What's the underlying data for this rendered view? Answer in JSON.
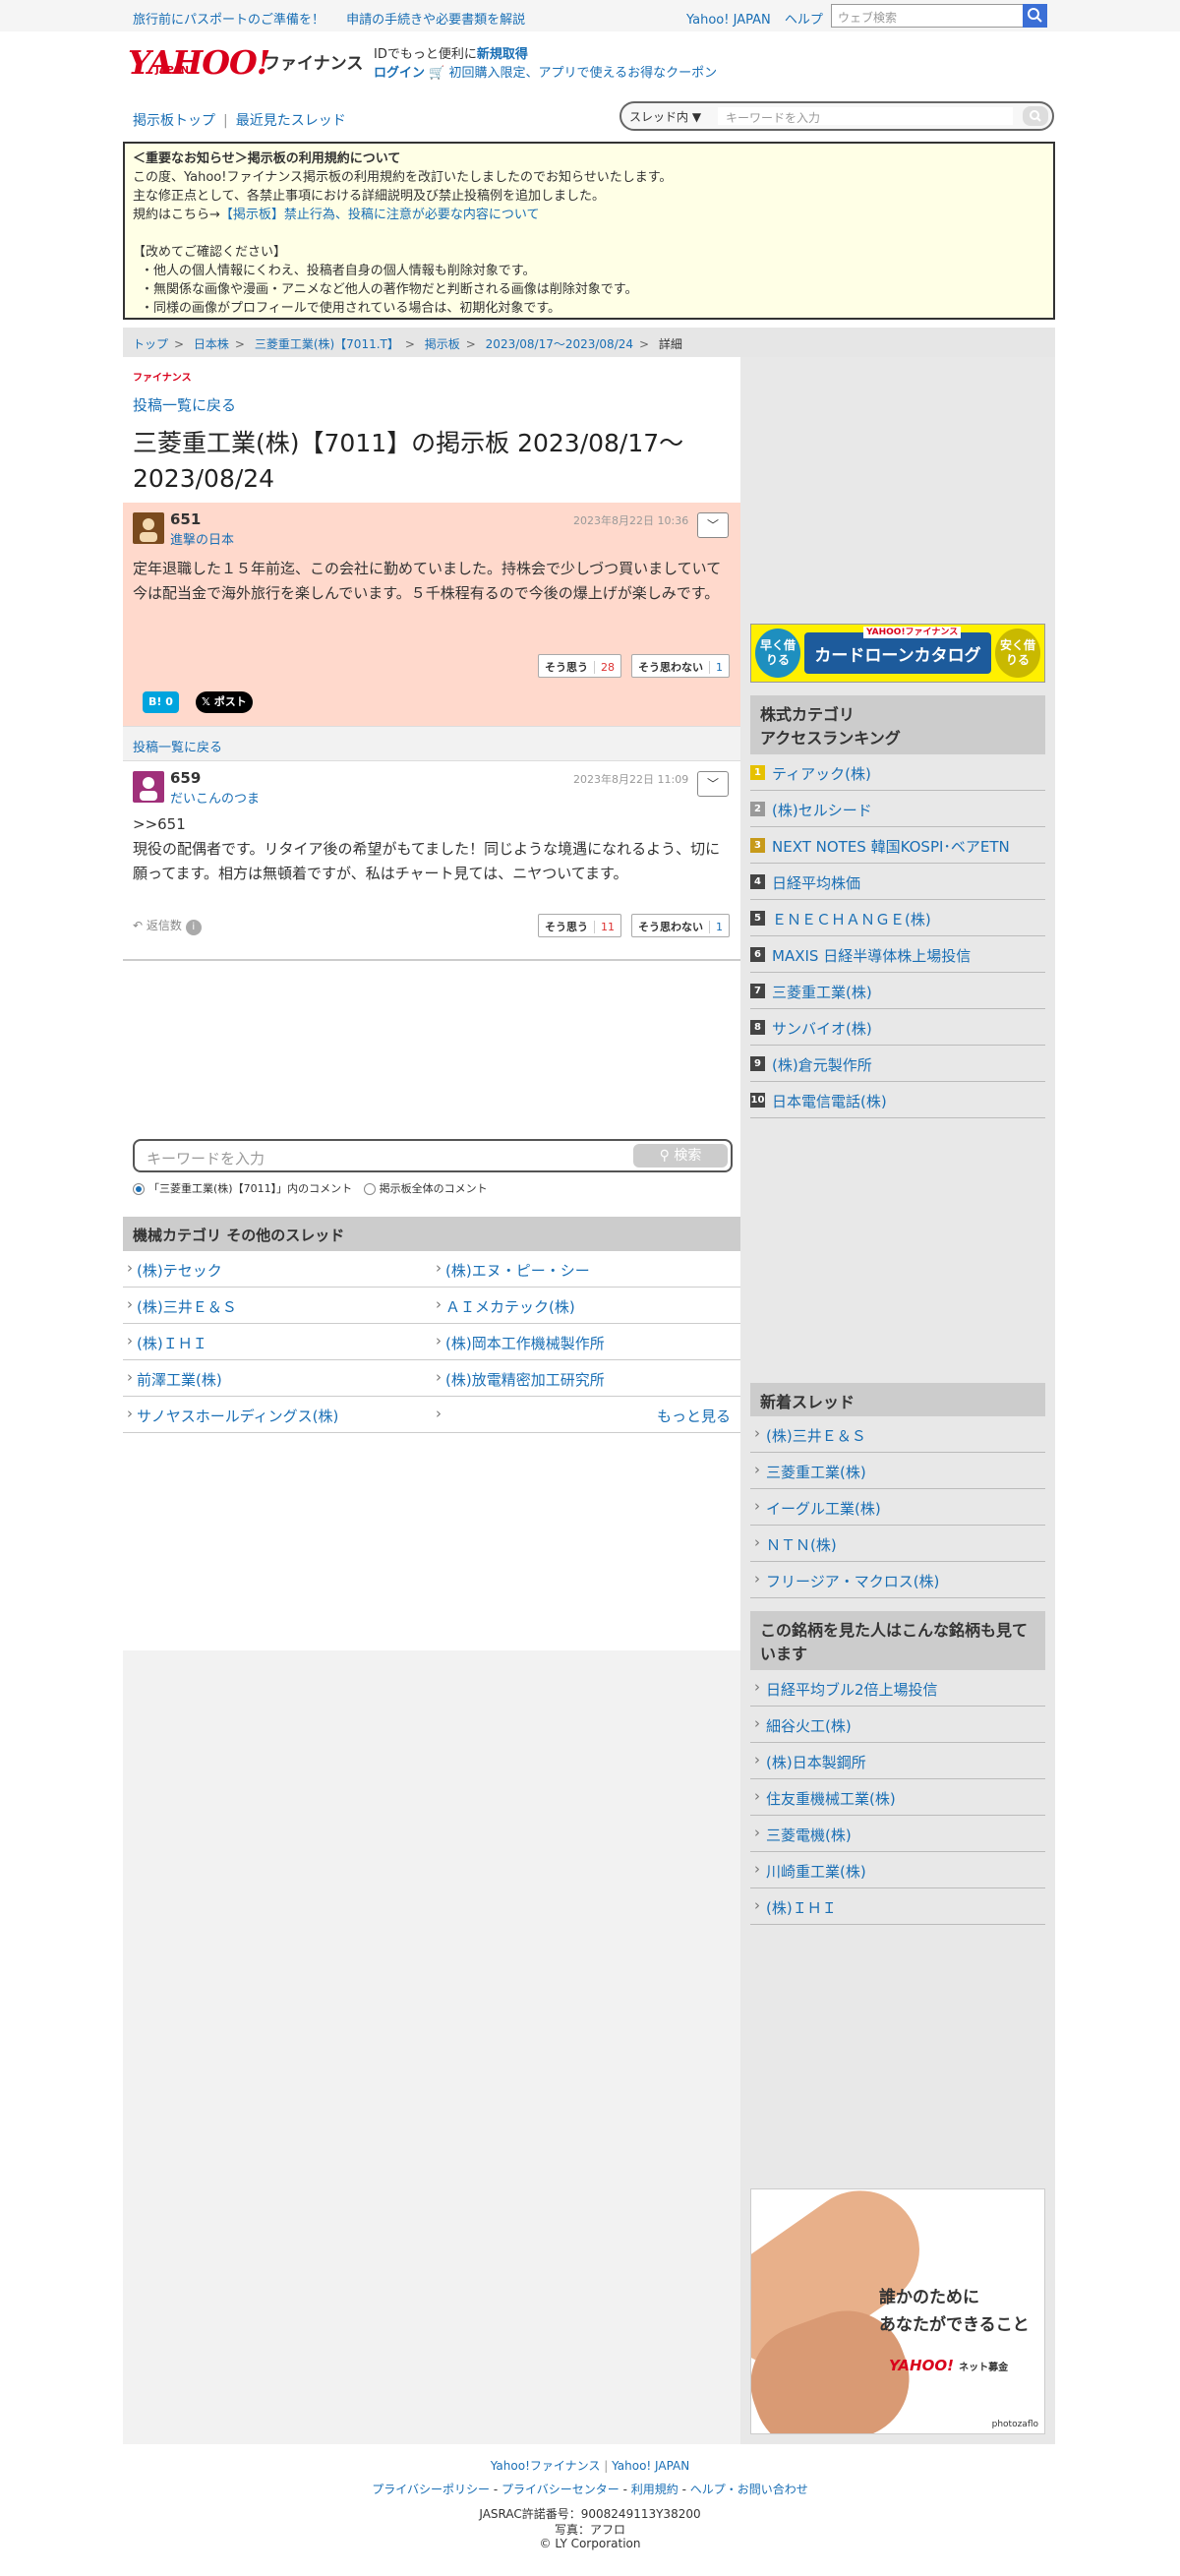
{
  "topbar": {
    "left_links": [
      "旅行前にパスポートのご準備を！",
      "申請の手続きや必要書類を解説"
    ],
    "right_links": [
      "Yahoo! JAPAN",
      "ヘルプ"
    ],
    "search_placeholder": "ウェブ検索"
  },
  "header": {
    "logo": "YAHOO!",
    "logo_sub": "JAPAN",
    "service": "ファイナンス",
    "id_text": "IDでもっと便利に",
    "signup": "新規取得",
    "login": "ログイン",
    "coupon": "初回購入限定、アプリで使えるお得なクーポン"
  },
  "subnav": {
    "board_top": "掲示板トップ",
    "recent": "最近見たスレッド",
    "scope": "スレッド内",
    "placeholder": "キーワードを入力"
  },
  "notice": {
    "title": "＜重要なお知らせ＞掲示板の利用規約について",
    "lines": [
      "この度、Yahoo!ファイナンス掲示板の利用規約を改訂いたしましたのでお知らせいたします。",
      "主な修正点として、各禁止事項における詳細説明及び禁止投稿例を追加しました。"
    ],
    "rule_prefix": "規約はこちら→",
    "rule_link": "【掲示板】禁止行為、投稿に注意が必要な内容について",
    "confirm": "【改めてご確認ください】",
    "bullets": [
      "・他人の個人情報にくわえ、投稿者自身の個人情報も削除対象です。",
      "・無関係な画像や漫画・アニメなど他人の著作物だと判断される画像は削除対象です。",
      "・同様の画像がプロフィールで使用されている場合は、初期化対象です。"
    ]
  },
  "breadcrumb": [
    "トップ",
    "日本株",
    "三菱重工業(株)【7011.T】",
    "掲示板",
    "2023/08/17〜2023/08/24",
    "詳細"
  ],
  "main": {
    "small_logo": "ファイナンス",
    "back": "投稿一覧に戻る",
    "title": "三菱重工業(株)【7011】の掲示板 2023/08/17〜2023/08/24"
  },
  "posts": [
    {
      "num": "651",
      "name": "進撃の日本",
      "date": "2023年8月22日 10:36",
      "body": "定年退職した１５年前迄、この会社に勤めていました。持株会で少しづつ買いましていて今は配当金で海外旅行を楽しんでいます。５千株程有るので今後の爆上げが楽しみです。",
      "yes_label": "そう思う",
      "yes": "28",
      "no_label": "そう思わない",
      "no": "1",
      "hatena": "B! 0",
      "xpost": "ポスト"
    },
    {
      "num": "659",
      "name": "だいこんのつま",
      "date": "2023年8月22日 11:09",
      "body": ">>651\n現役の配偶者です。リタイア後の希望がもてました！同じような境遇になれるよう、切に願ってます。相方は無頓着ですが、私はチャート見ては、ニヤついてます。",
      "yes_label": "そう思う",
      "yes": "11",
      "no_label": "そう思わない",
      "no": "1",
      "reply": "返信数"
    }
  ],
  "back2": "投稿一覧に戻る",
  "search": {
    "placeholder": "キーワードを入力",
    "button": "検索",
    "opt1": "「三菱重工業(株)【7011】」内のコメント",
    "opt2": "掲示板全体のコメント"
  },
  "other": {
    "title": "機械カテゴリ その他のスレッド",
    "items": [
      "(株)テセック",
      "(株)エヌ・ピー・シー",
      "(株)三井Ｅ＆Ｓ",
      "ＡＩメカテック(株)",
      "(株)ＩＨＩ",
      "(株)岡本工作機械製作所",
      "前澤工業(株)",
      "(株)放電精密加工研究所",
      "サノヤスホールディングス(株)"
    ],
    "more": "もっと見る"
  },
  "ad1": {
    "left": "早く借りる",
    "center": "カードローンカタログ",
    "brand": "YAHOO!ファイナンス",
    "right": "安く借りる"
  },
  "ranking": {
    "title1": "株式カテゴリ",
    "title2": "アクセスランキング",
    "items": [
      "ティアック(株)",
      "(株)セルシード",
      "NEXT NOTES 韓国KOSPI･ベアETN",
      "日経平均株価",
      "ＥＮＥＣＨＡＮＧＥ(株)",
      "MAXIS 日経半導体株上場投信",
      "三菱重工業(株)",
      "サンバイオ(株)",
      "(株)倉元製作所",
      "日本電信電話(株)"
    ]
  },
  "new_threads": {
    "title": "新着スレッド",
    "items": [
      "(株)三井Ｅ＆Ｓ",
      "三菱重工業(株)",
      "イーグル工業(株)",
      "ＮＴＮ(株)",
      "フリージア・マクロス(株)"
    ]
  },
  "also_viewed": {
    "title": "この銘柄を見た人はこんな銘柄も見ています",
    "items": [
      "日経平均ブル2倍上場投信",
      "細谷火工(株)",
      "(株)日本製鋼所",
      "住友重機械工業(株)",
      "三菱電機(株)",
      "川崎重工業(株)",
      "(株)ＩＨＩ"
    ]
  },
  "ad2": {
    "line1": "誰かのために",
    "line2": "あなたができること",
    "brand": "YAHOO!",
    "brand_sub": "ネット募金",
    "photo": "photozaflo"
  },
  "footer": {
    "links1": [
      "Yahoo!ファイナンス",
      "Yahoo! JAPAN"
    ],
    "links2": [
      "プライバシーポリシー",
      "プライバシーセンター",
      "利用規約",
      "ヘルプ・お問い合わせ"
    ],
    "jasrac": "JASRAC許諾番号：9008249113Y38200",
    "photo": "写真：アフロ",
    "copy": "© LY Corporation"
  },
  "colors": {
    "link": "#1a6fb5",
    "highlight": "#ffd9cc",
    "notice_bg": "#ffffe6",
    "brand": "#d9001b"
  }
}
